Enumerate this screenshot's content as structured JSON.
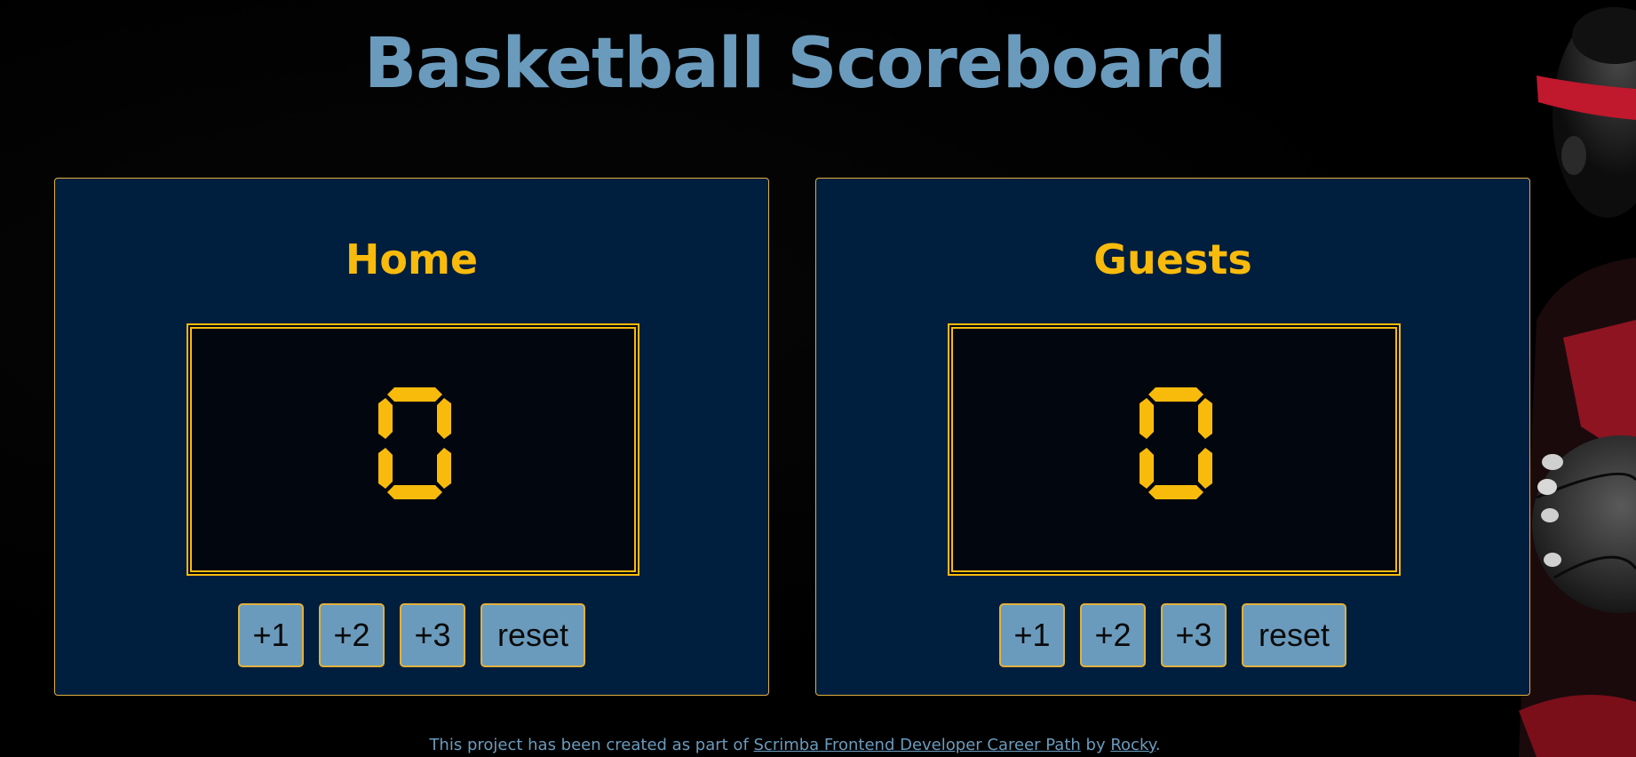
{
  "header": {
    "title": "Basketball Scoreboard"
  },
  "teams": [
    {
      "name": "Home",
      "score": "0",
      "buttons": [
        "+1",
        "+2",
        "+3",
        "reset"
      ]
    },
    {
      "name": "Guests",
      "score": "0",
      "buttons": [
        "+1",
        "+2",
        "+3",
        "reset"
      ]
    }
  ],
  "footer": {
    "prefix": "This project has been created as part of ",
    "link1": "Scrimba Frontend Developer Career Path",
    "middle": " by ",
    "link2": "Rocky",
    "suffix": "."
  },
  "colors": {
    "title": "#6a9bbd",
    "accent": "#f8bb0c",
    "panel": "#001e3d",
    "button": "#6a9bbd",
    "scorebox": "#02060f"
  },
  "icons": {
    "background_image": "basketball-player-image"
  }
}
